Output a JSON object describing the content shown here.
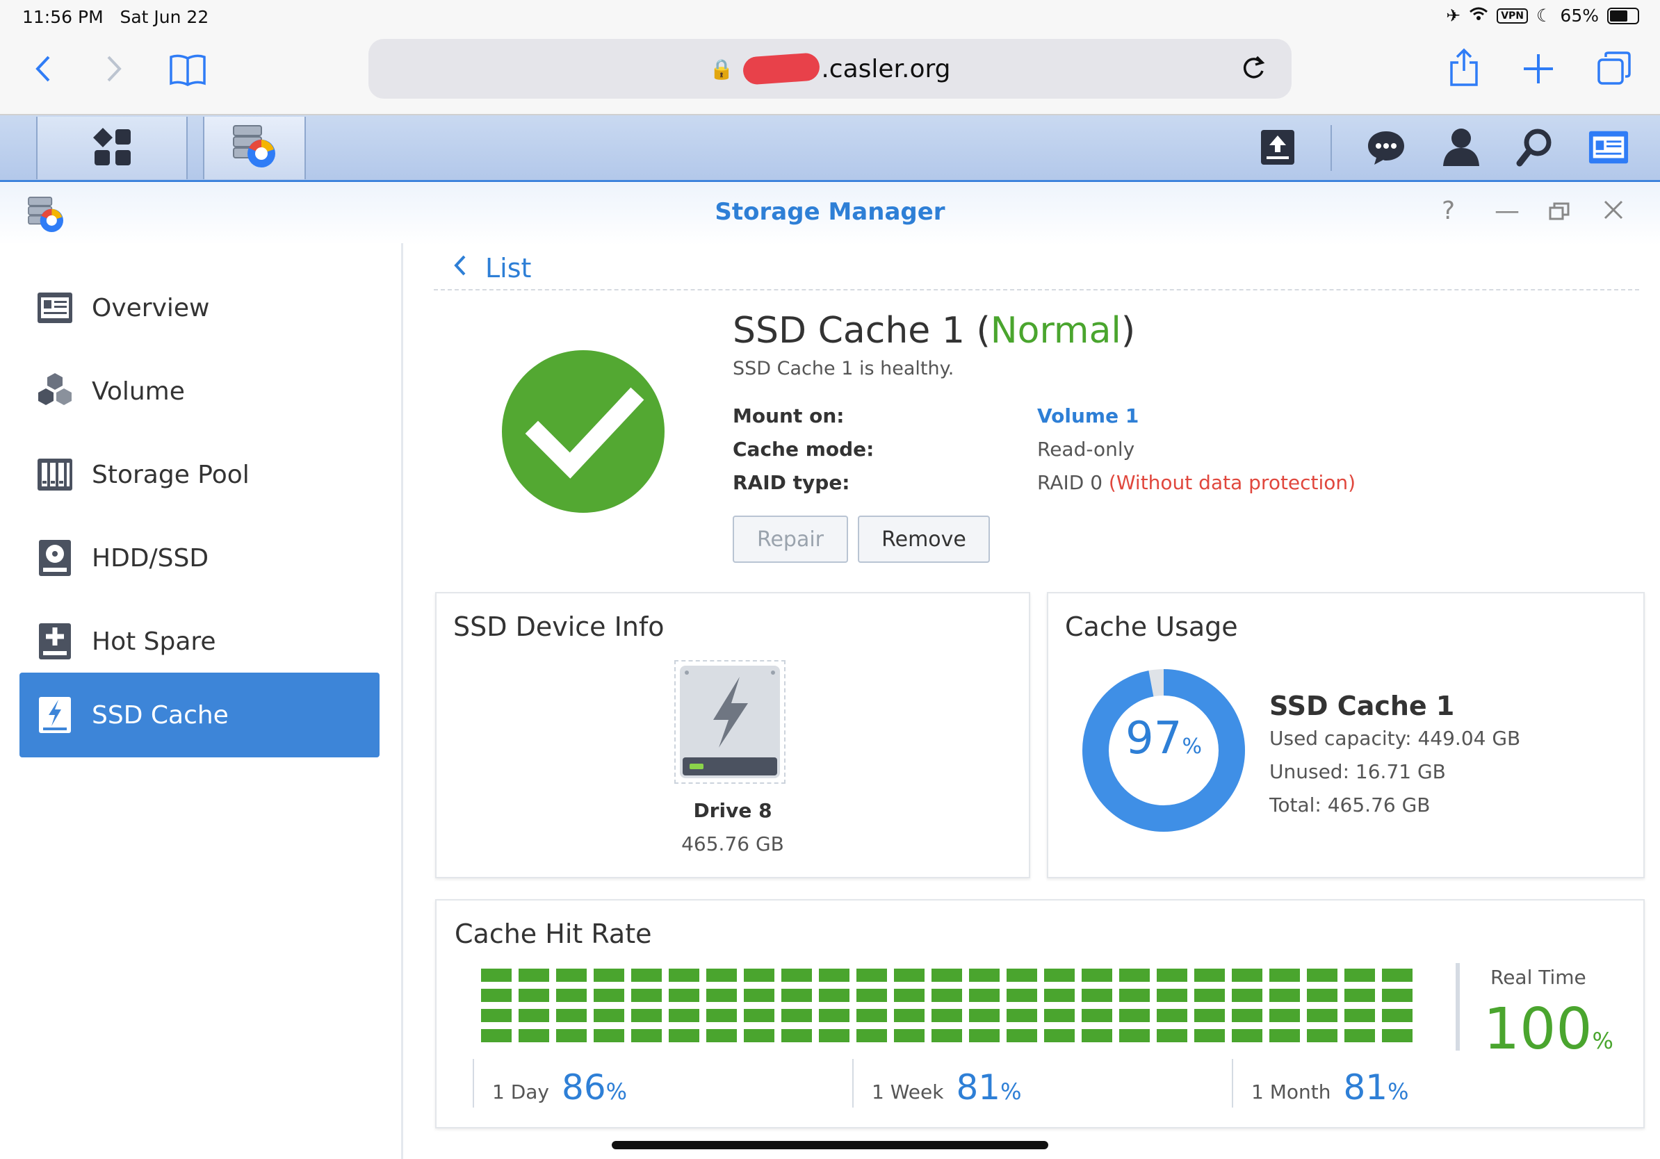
{
  "status_bar": {
    "time": "11:56 PM",
    "date": "Sat Jun 22",
    "vpn": "VPN",
    "battery": "65%"
  },
  "browser": {
    "url_visible": ".casler.org"
  },
  "window": {
    "title": "Storage Manager"
  },
  "sidebar": {
    "items": [
      {
        "label": "Overview",
        "icon": "overview-icon"
      },
      {
        "label": "Volume",
        "icon": "volume-icon"
      },
      {
        "label": "Storage Pool",
        "icon": "storage-pool-icon"
      },
      {
        "label": "HDD/SSD",
        "icon": "hdd-icon"
      },
      {
        "label": "Hot Spare",
        "icon": "hot-spare-icon"
      },
      {
        "label": "SSD Cache",
        "icon": "ssd-cache-icon",
        "active": true
      }
    ]
  },
  "main": {
    "back_label": "List",
    "cache_name": "SSD Cache 1 (",
    "cache_status": "Normal",
    "cache_close": ")",
    "health_text": "SSD Cache 1 is healthy.",
    "mount_label": "Mount on:",
    "mount_value": "Volume 1",
    "mode_label": "Cache mode:",
    "mode_value": "Read-only",
    "raid_label": "RAID type:",
    "raid_value": "RAID 0",
    "raid_warning": "(Without data protection)",
    "repair_label": "Repair",
    "remove_label": "Remove"
  },
  "device_info": {
    "title": "SSD Device Info",
    "drive_name": "Drive 8",
    "drive_size": "465.76 GB"
  },
  "cache_usage": {
    "title": "Cache Usage",
    "percent": "97",
    "pct_sign": "%",
    "used_fraction": 0.97,
    "cache_title": "SSD Cache 1",
    "used": "Used capacity: 449.04 GB",
    "unused": "Unused: 16.71 GB",
    "total": "Total: 465.76 GB"
  },
  "hit_rate": {
    "title": "Cache Hit Rate",
    "realtime_label": "Real Time",
    "realtime_value": "100",
    "pct_sign": "%",
    "day_label": "1 Day",
    "day_value": "86",
    "week_label": "1 Week",
    "week_value": "81",
    "month_label": "1 Month",
    "month_value": "81"
  },
  "colors": {
    "accent": "#3d85d8",
    "ok": "#4aa52e",
    "warning": "#e0473d",
    "ring_light": "#4da6f2",
    "ring_dark": "#3a78dc"
  }
}
